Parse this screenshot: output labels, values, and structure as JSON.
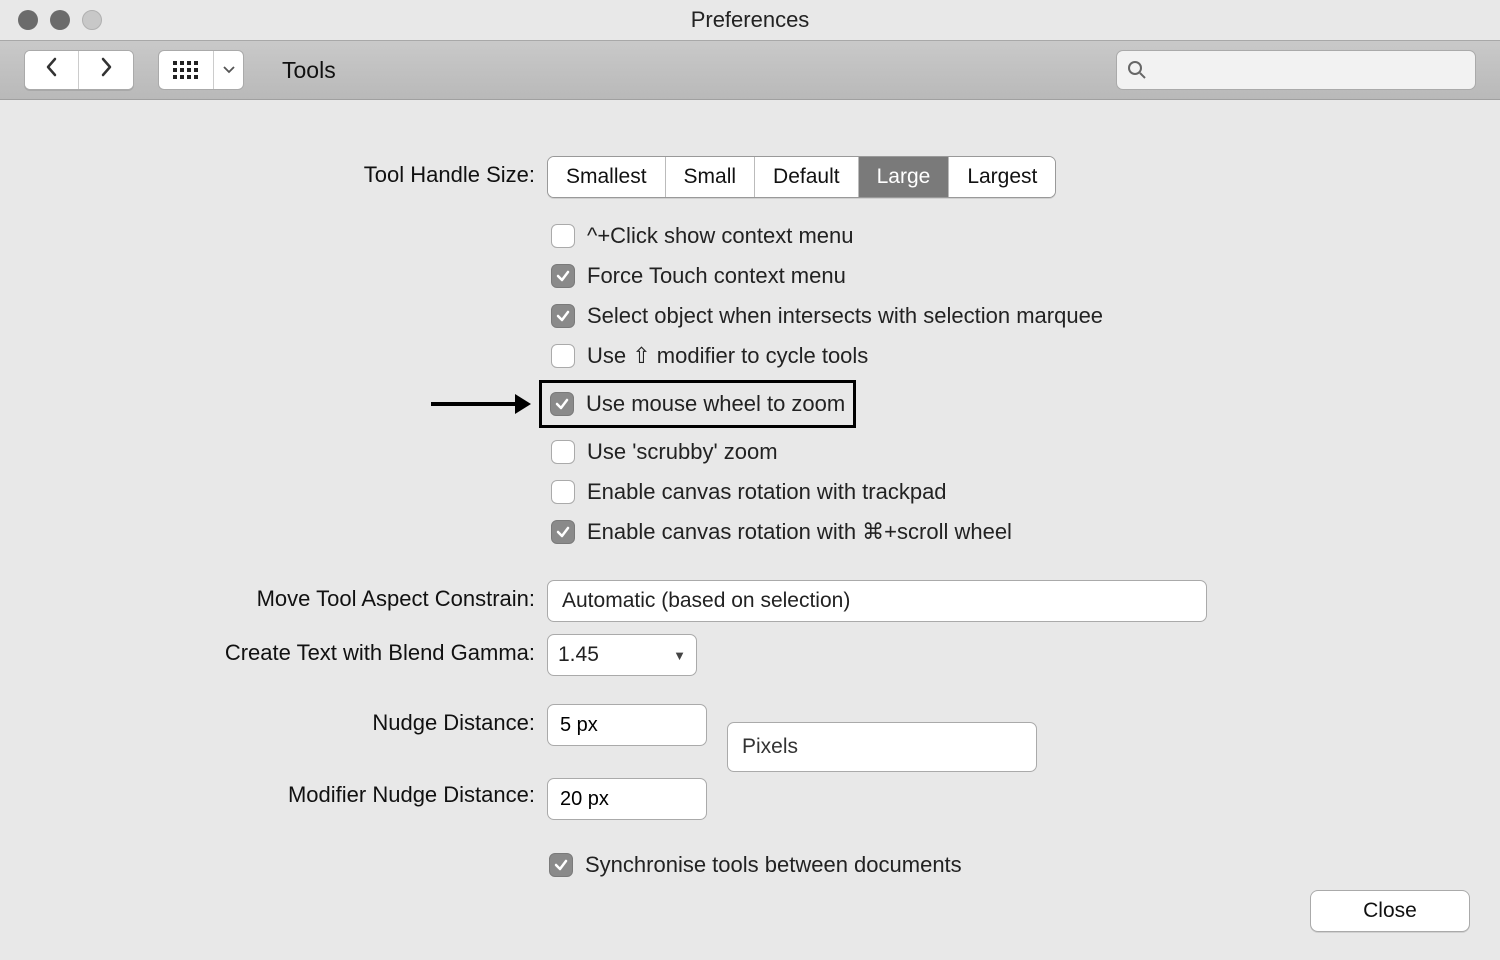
{
  "window": {
    "title": "Preferences"
  },
  "toolbar": {
    "section": "Tools",
    "search_placeholder": ""
  },
  "labels": {
    "tool_handle_size": "Tool Handle Size:",
    "move_tool_aspect": "Move Tool Aspect Constrain:",
    "blend_gamma": "Create Text with Blend Gamma:",
    "nudge_distance": "Nudge Distance:",
    "modifier_nudge_distance": "Modifier Nudge Distance:"
  },
  "segments": {
    "smallest": "Smallest",
    "small": "Small",
    "default": "Default",
    "large": "Large",
    "largest": "Largest",
    "selected": "large"
  },
  "checks": {
    "ctrl_click_context": {
      "label": "^+Click show context menu",
      "checked": false
    },
    "force_touch_context": {
      "label": "Force Touch context menu",
      "checked": true
    },
    "select_intersect": {
      "label": "Select object when intersects with selection marquee",
      "checked": true
    },
    "shift_cycle": {
      "label": "Use ⇧ modifier to cycle tools",
      "checked": false
    },
    "wheel_zoom": {
      "label": "Use mouse wheel to zoom",
      "checked": true
    },
    "scrubby_zoom": {
      "label": "Use 'scrubby' zoom",
      "checked": false
    },
    "rotate_trackpad": {
      "label": "Enable canvas rotation with trackpad",
      "checked": false
    },
    "rotate_scroll": {
      "label": "Enable canvas rotation with ⌘+scroll wheel",
      "checked": true
    },
    "sync_tools": {
      "label": "Synchronise tools between documents",
      "checked": true
    }
  },
  "values": {
    "move_tool_aspect_value": "Automatic (based on selection)",
    "blend_gamma_value": "1.45",
    "nudge_value": "5 px",
    "modifier_nudge_value": "20 px",
    "nudge_unit": "Pixels"
  },
  "footer": {
    "close": "Close"
  }
}
